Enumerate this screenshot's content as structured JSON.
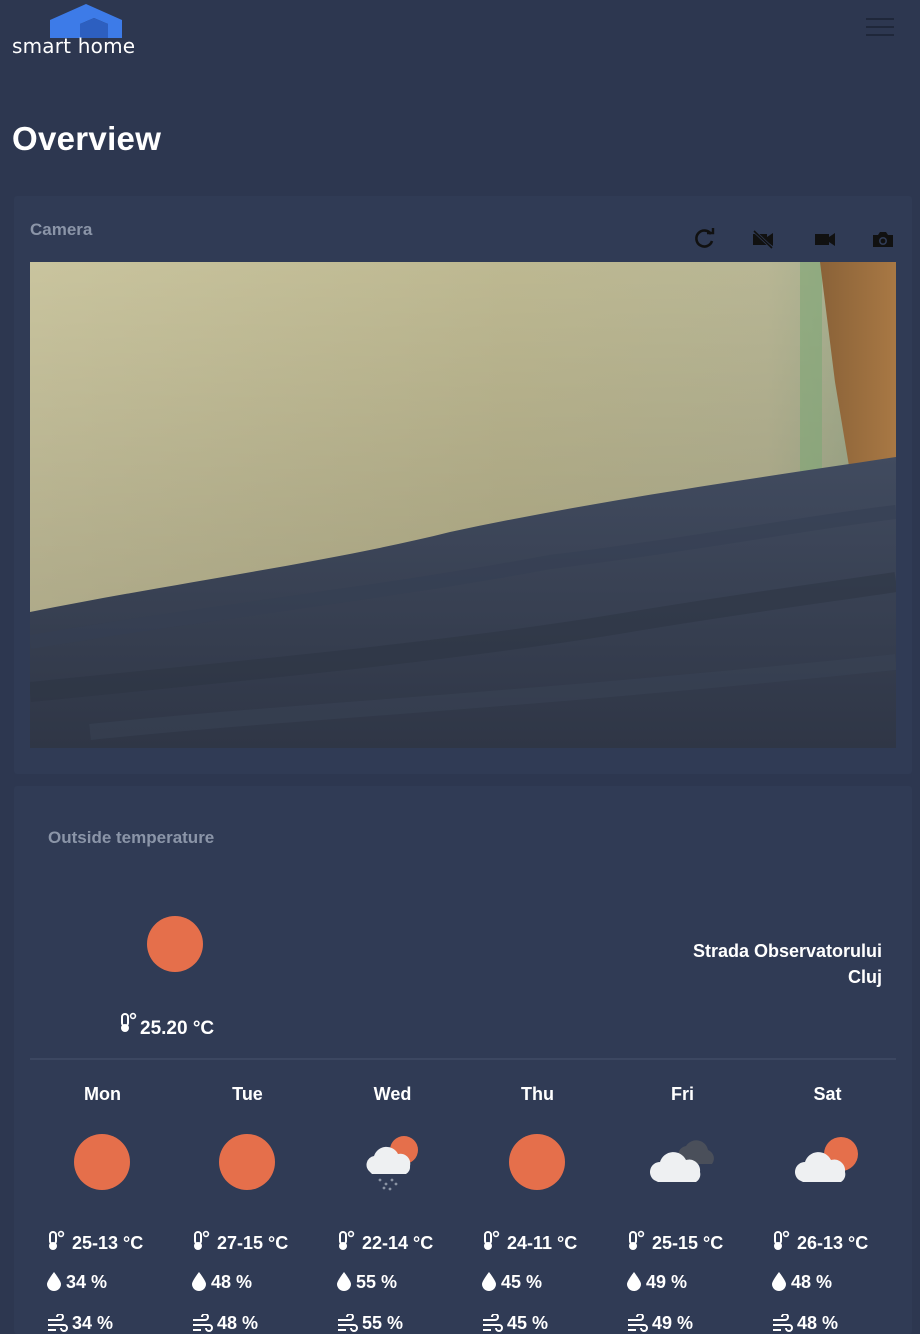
{
  "header": {
    "logo_text": "smart home",
    "menu_icon": "hamburger-menu-icon"
  },
  "page": {
    "title": "Overview"
  },
  "camera": {
    "label": "Camera",
    "controls": [
      "refresh-icon",
      "video-off-icon",
      "video-camera-icon",
      "camera-snapshot-icon"
    ]
  },
  "weather": {
    "label": "Outside temperature",
    "current": {
      "icon": "sun-icon",
      "temperature": "25.20 °C"
    },
    "location": {
      "street": "Strada Observatorului",
      "city": "Cluj"
    },
    "forecast": [
      {
        "day": "Mon",
        "icon": "sun-icon",
        "temp": "25-13 °C",
        "humidity": "34 %",
        "wind": "34 %"
      },
      {
        "day": "Tue",
        "icon": "sun-icon",
        "temp": "27-15 °C",
        "humidity": "48 %",
        "wind": "48 %"
      },
      {
        "day": "Wed",
        "icon": "rain-cloud-sun-icon",
        "temp": "22-14 °C",
        "humidity": "55 %",
        "wind": "55 %"
      },
      {
        "day": "Thu",
        "icon": "sun-icon",
        "temp": "24-11 °C",
        "humidity": "45 %",
        "wind": "45 %"
      },
      {
        "day": "Fri",
        "icon": "dark-clouds-icon",
        "temp": "25-15 °C",
        "humidity": "49 %",
        "wind": "49 %"
      },
      {
        "day": "Sat",
        "icon": "cloud-sun-icon",
        "temp": "26-13 °C",
        "humidity": "48 %",
        "wind": "48 %"
      }
    ]
  },
  "colors": {
    "background": "#2d3750",
    "card": "#303b55",
    "accent_sun": "#e56f4b",
    "logo_blue": "#3d7be8",
    "muted_label": "#8b95a8"
  }
}
